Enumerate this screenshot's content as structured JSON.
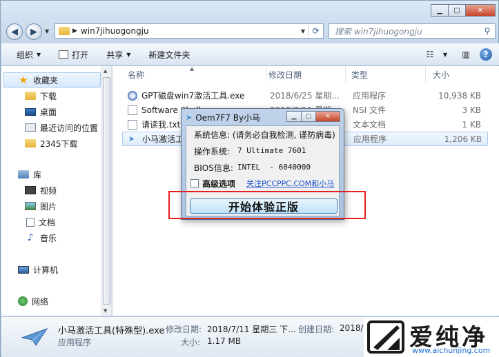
{
  "address": {
    "path": "win7jihuogongju"
  },
  "search": {
    "placeholder": "搜索 win7jihuogongju"
  },
  "toolbar": {
    "organize": "组织",
    "open": "打开",
    "share": "共享",
    "new_folder": "新建文件夹"
  },
  "nav": {
    "favorites": "收藏夹",
    "download": "下载",
    "desktop": "桌面",
    "recent": "最近访问的位置",
    "dl2345": "2345下载",
    "library": "库",
    "video": "视频",
    "pictures": "图片",
    "documents": "文档",
    "music": "音乐",
    "computer": "计算机",
    "network": "网络"
  },
  "columns": {
    "name": "名称",
    "date": "修改日期",
    "type": "类型",
    "size": "大小"
  },
  "files": [
    {
      "name": "GPT磁盘win7激活工具.exe",
      "date": "2018/6/25 星期...",
      "type": "应用程序",
      "size": "10,938 KB"
    },
    {
      "name": "Software Shell...",
      "date": "2018/7/11 星期...",
      "type": "NSI 文件",
      "size": "3 KB"
    },
    {
      "name": "请读我.txt",
      "date": "",
      "type": "文本文档",
      "size": "1 KB"
    },
    {
      "name": "小马激活工具(特殊型).exe",
      "date": "",
      "type": "应用程序",
      "size": "1,206 KB"
    }
  ],
  "dialog": {
    "title": "Oem7F7 By小马",
    "sysinfo": "系统信息: (请务必自我检测, 谨防病毒)",
    "os_label": "操作系统:",
    "os_value": "7 Ultimate 7601",
    "bios_label": "BIOS信息:",
    "bios_value": "INTEL  - 6040000",
    "advanced": "高级选项",
    "follow": "关注PCCPPC.COM和小马",
    "start": "开始体验正版"
  },
  "details": {
    "filename": "小马激活工具(特殊型).exe",
    "filetype": "应用程序",
    "modified_label": "修改日期:",
    "modified_value": "2018/7/11 星期三 下...",
    "created_label": "创建日期:",
    "created_value": "2018/7/",
    "size_label": "大小:",
    "size_value": "1.17 MB"
  },
  "watermark": {
    "brand": "爱纯净",
    "url": "www.aichunjing.com"
  },
  "colors": {
    "highlight_box": "#e3201b",
    "link": "#1a4fd0",
    "close_button": "#c7452b"
  }
}
